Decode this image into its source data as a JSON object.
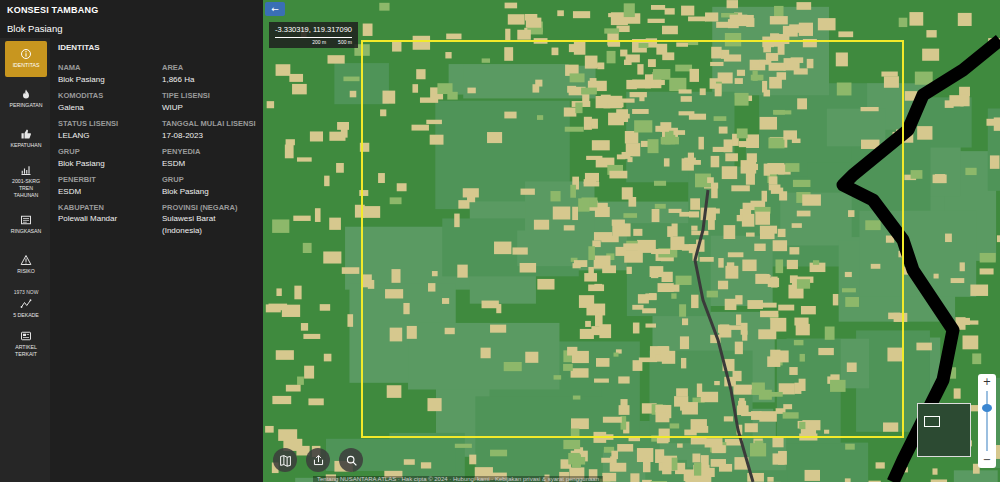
{
  "panel": {
    "title": "KONSESI TAMBANG",
    "subtitle": "Blok Pasiang"
  },
  "nav": [
    {
      "label": "IDENTITAS",
      "kind": "info",
      "selected": true
    },
    {
      "label": "PERINGATAN",
      "kind": "fire",
      "selected": false
    },
    {
      "label": "KEPATUHAN",
      "kind": "thumb",
      "selected": false
    },
    {
      "label": "2001-SKRG TREN TAHUNAN",
      "kind": "chart",
      "selected": false
    },
    {
      "label": "RINGKASAN",
      "kind": "doc",
      "selected": false
    },
    {
      "label": "RISIKO",
      "kind": "warning",
      "selected": false
    },
    {
      "label": "5 DEKADE",
      "caption": "1973 NOW",
      "kind": "timeline",
      "selected": false
    },
    {
      "label": "ARTIKEL TERKAIT",
      "kind": "article",
      "selected": false
    }
  ],
  "section": "IDENTITAS",
  "fields": [
    {
      "label": "NAMA",
      "value": "Blok Pasiang"
    },
    {
      "label": "AREA",
      "value": "1,866 Ha"
    },
    {
      "label": "KOMODITAS",
      "value": "Galena"
    },
    {
      "label": "TIPE LISENSI",
      "value": "WIUP"
    },
    {
      "label": "STATUS LISENSI",
      "value": "LELANG"
    },
    {
      "label": "TANGGAL MULAI LISENSI",
      "value": "17-08-2023"
    },
    {
      "label": "GRUP",
      "value": "Blok Pasiang"
    },
    {
      "label": "PENYEDIA",
      "value": "ESDM"
    },
    {
      "label": "PENERBIT",
      "value": "ESDM"
    },
    {
      "label": "GRUP",
      "value": "Blok Pasiang"
    },
    {
      "label": "KABUPATEN",
      "value": "Polewali Mandar"
    },
    {
      "label": "PROVINSI (NEGARA)",
      "value": "Sulawesi Barat (Indonesia)"
    }
  ],
  "map": {
    "back": "←",
    "coords": "-3.330319, 119.317090",
    "scale": [
      "200 m",
      "500 m"
    ],
    "zoom_in": "+",
    "zoom_out": "−",
    "zoom_level": 0.75,
    "footer": "Tentang NUSANTARA ATLAS · Hak cipta © 2024 · Hubungi kami · Kebijakan privasi & syarat penggunaan"
  }
}
